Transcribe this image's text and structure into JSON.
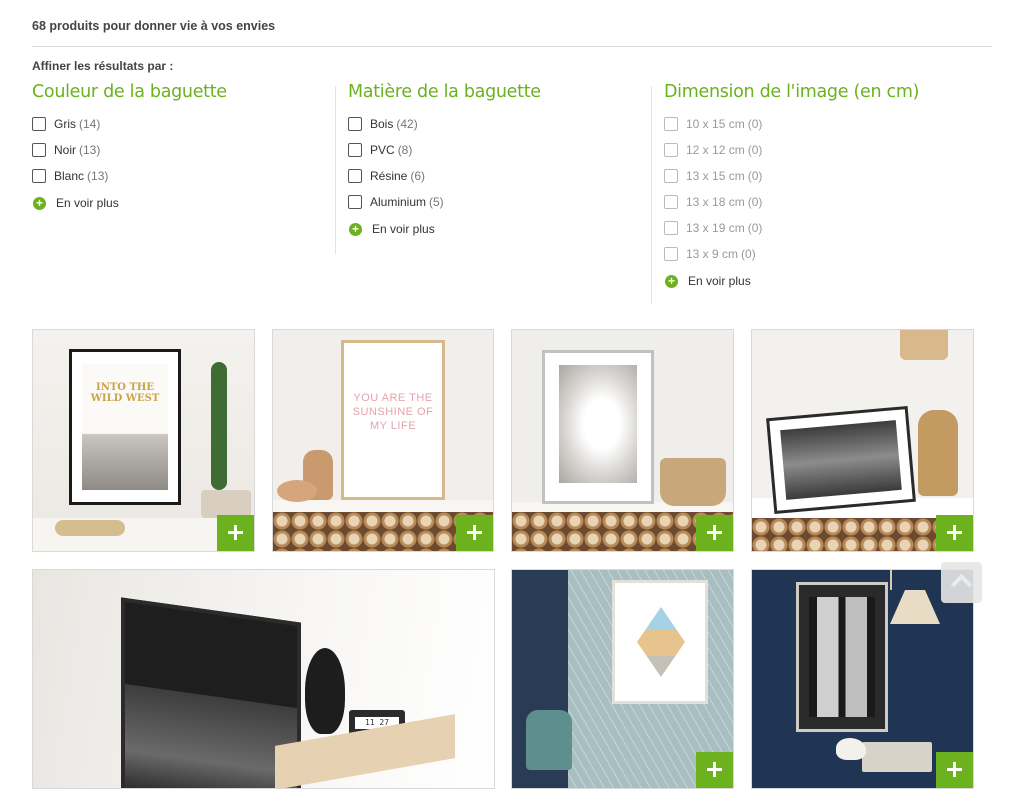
{
  "results_count": "68 produits pour donner vie à vos envies",
  "refine_label": "Affiner les résultats par :",
  "filters": {
    "couleur": {
      "title": "Couleur de la baguette",
      "options": [
        {
          "label": "Gris",
          "count": "(14)"
        },
        {
          "label": "Noir",
          "count": "(13)"
        },
        {
          "label": "Blanc",
          "count": "(13)"
        }
      ],
      "more": "En voir plus"
    },
    "matiere": {
      "title": "Matière de la baguette",
      "options": [
        {
          "label": "Bois",
          "count": "(42)"
        },
        {
          "label": "PVC",
          "count": "(8)"
        },
        {
          "label": "Résine",
          "count": "(6)"
        },
        {
          "label": "Aluminium",
          "count": "(5)"
        }
      ],
      "more": "En voir plus"
    },
    "dimension": {
      "title": "Dimension de l'image (en cm)",
      "options": [
        {
          "label": "10 x 15 cm",
          "count": "(0)"
        },
        {
          "label": "12 x 12 cm",
          "count": "(0)"
        },
        {
          "label": "13 x 15 cm",
          "count": "(0)"
        },
        {
          "label": "13 x 18 cm",
          "count": "(0)"
        },
        {
          "label": "13 x 19 cm",
          "count": "(0)"
        },
        {
          "label": "13 x 9 cm",
          "count": "(0)"
        }
      ],
      "more": "En voir plus"
    }
  },
  "products": [
    {
      "poster_text": "INTO THE WILD WEST"
    },
    {
      "poster_text": "YOU ARE THE SUNSHINE OF MY LIFE"
    },
    {
      "poster_text": ""
    },
    {
      "poster_text": ""
    },
    {
      "clock_text": "11 27"
    },
    {
      "poster_text": ""
    },
    {
      "poster_text": ""
    }
  ],
  "colors": {
    "accent_green": "#6bb21e",
    "text_dark": "#333333",
    "muted": "#9a9a9a"
  }
}
